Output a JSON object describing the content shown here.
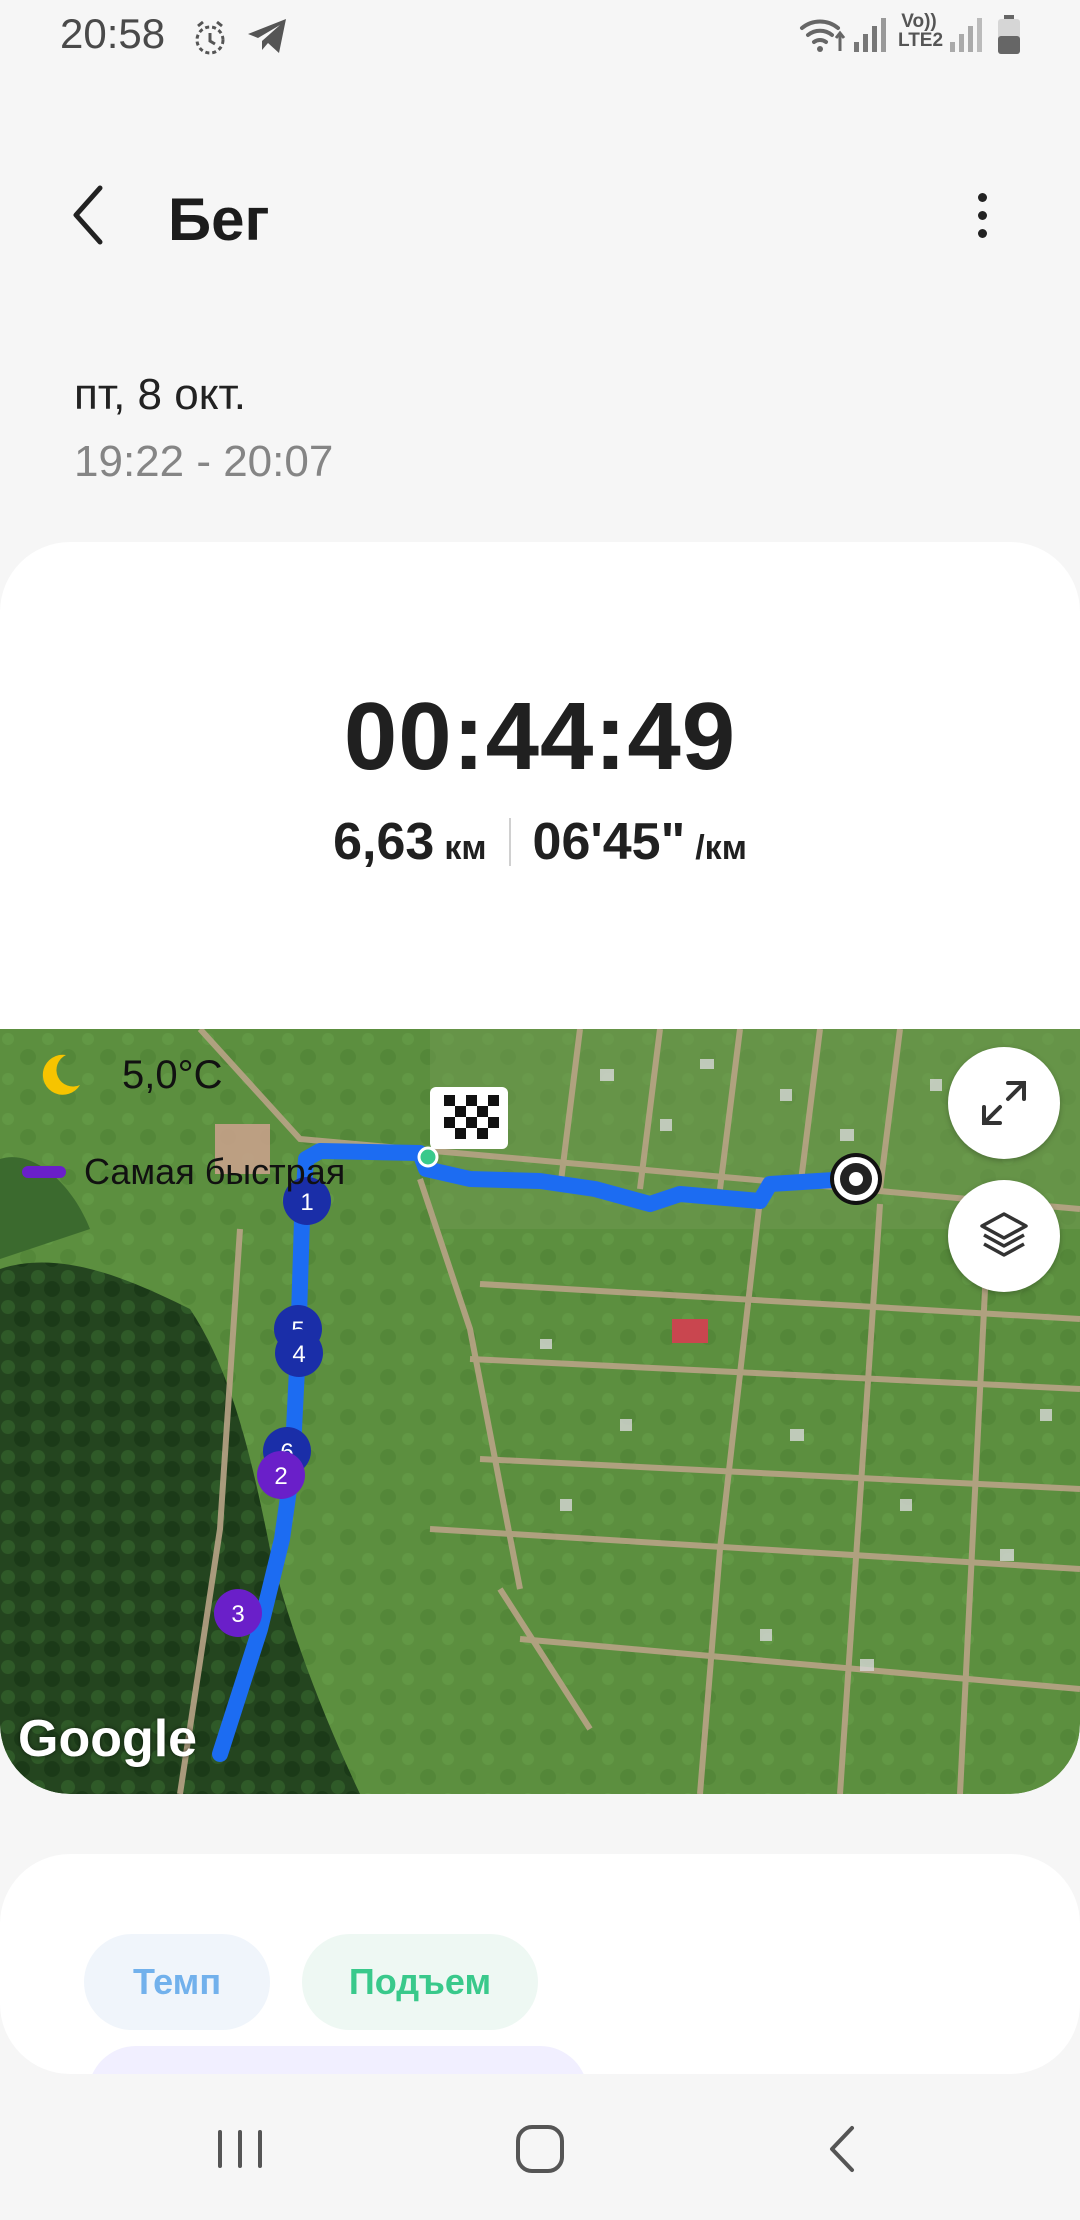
{
  "status_bar": {
    "time": "20:58",
    "left_icons": [
      "alarm-clock-icon",
      "telegram-icon"
    ],
    "right_icons": [
      "wifi-icon",
      "signal-icon",
      "volte-icon",
      "signal-icon",
      "battery-icon"
    ],
    "volte_label": "Vo))",
    "lte_label": "LTE2"
  },
  "header": {
    "title": "Бег",
    "back_icon": "chevron-left-icon",
    "more_icon": "more-vertical-icon"
  },
  "workout": {
    "date": "пт, 8 окт.",
    "time_range": "19:22 - 20:07",
    "duration": "00:44:49",
    "distance_value": "6,63",
    "distance_unit": "км",
    "pace_value": "06'45\"",
    "pace_unit": "/км"
  },
  "map": {
    "weather_icon": "moon-icon",
    "temperature": "5,0°C",
    "legend_label": "Самая быстрая",
    "legend_color": "#6a1fc9",
    "route_color": "#1c6cf2",
    "km_markers": [
      "1",
      "5",
      "4",
      "6",
      "2",
      "3"
    ],
    "expand_icon": "expand-icon",
    "layers_icon": "layers-icon",
    "finish_icon": "finish-flag-icon",
    "start_icon": "start-point-icon",
    "attribution": "Google"
  },
  "charts": {
    "tabs": [
      "Темп",
      "Подъем"
    ],
    "pace_color": "#72b1ec",
    "climb_color": "#39c98b"
  },
  "nav_bar": {
    "recent_icon": "recent-apps-icon",
    "home_icon": "home-icon",
    "back_icon": "back-icon"
  }
}
